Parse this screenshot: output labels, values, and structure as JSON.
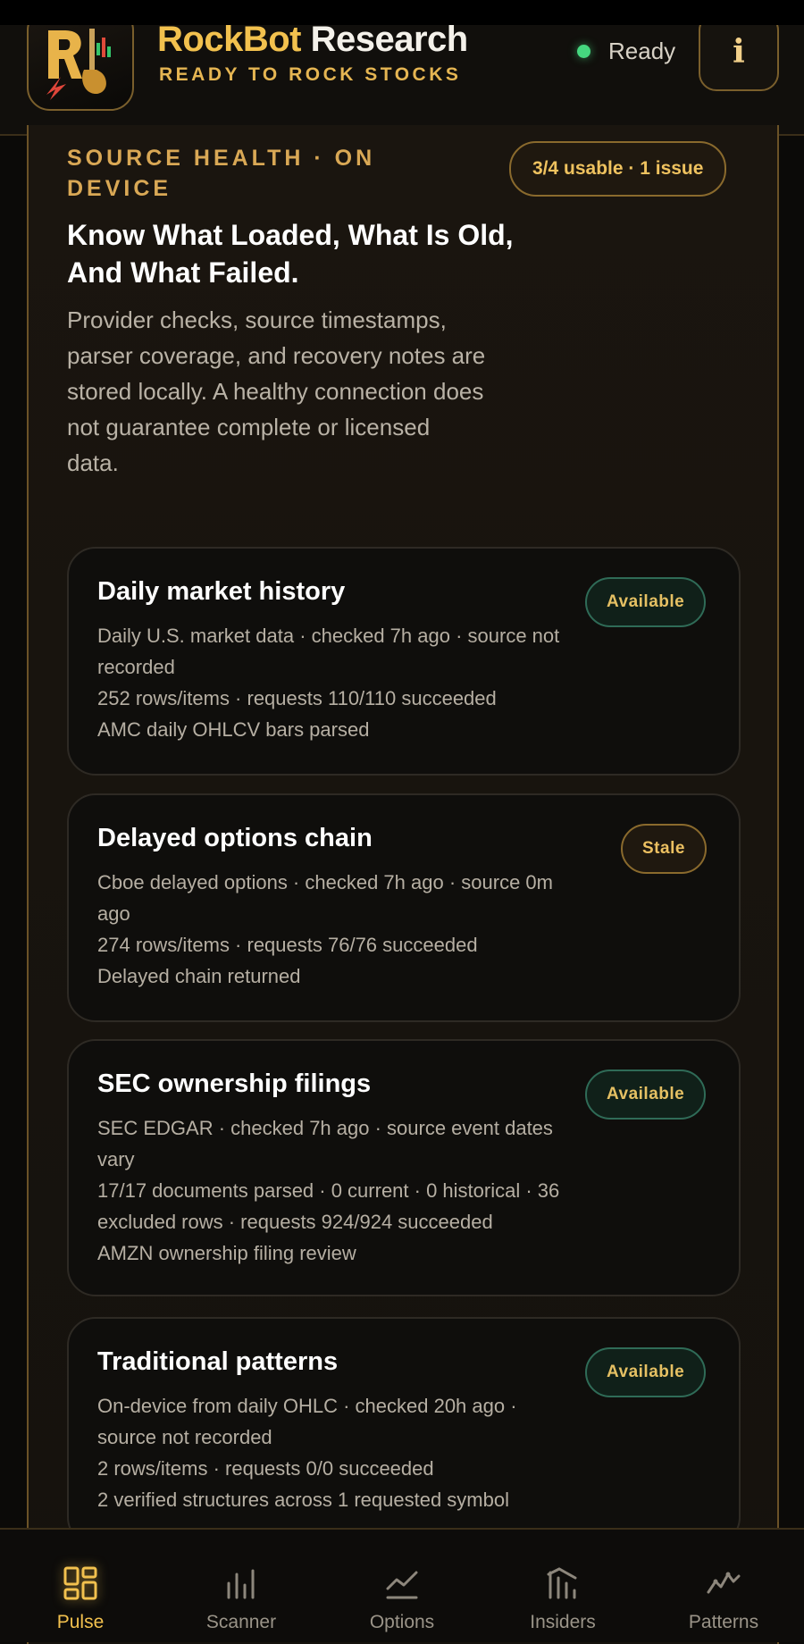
{
  "header": {
    "title_part1": "RockBot",
    "title_part2": " Research",
    "subtitle": "READY TO ROCK STOCKS",
    "status_label": "Ready",
    "info_label": "i",
    "logo_letter": "R",
    "logo_icon": "guitar-chart-logo"
  },
  "source_health": {
    "eyebrow": "SOURCE HEALTH · ON DEVICE",
    "summary_badge": "3/4 usable · 1 issue",
    "headline": "Know What Loaded, What Is Old, And What Failed.",
    "description": "Provider checks, source timestamps, parser coverage, and recovery notes are stored locally. A healthy connection does not guarantee complete or licensed data."
  },
  "sources": [
    {
      "title": "Daily market history",
      "status": "Available",
      "line1": "Daily U.S. market data · checked 7h ago · source not recorded",
      "line2": "252 rows/items · requests 110/110 succeeded",
      "line3": "AMC daily OHLCV bars parsed"
    },
    {
      "title": "Delayed options chain",
      "status": "Stale",
      "line1": "Cboe delayed options · checked 7h ago · source 0m ago",
      "line2": "274 rows/items · requests 76/76 succeeded",
      "line3": "Delayed chain returned"
    },
    {
      "title": "SEC ownership filings",
      "status": "Available",
      "line1": "SEC EDGAR · checked 7h ago · source event dates vary",
      "line2": "17/17 documents parsed · 0 current · 0 historical · 36 excluded rows · requests 924/924 succeeded",
      "line3": "AMZN ownership filing review"
    },
    {
      "title": "Traditional patterns",
      "status": "Available",
      "line1": "On-device from daily OHLC · checked 20h ago · source not recorded",
      "line2": "2 rows/items · requests 0/0 succeeded",
      "line3": "2 verified structures across 1 requested symbol"
    }
  ],
  "nav": [
    {
      "label": "Pulse",
      "icon": "dashboard-grid-icon",
      "active": true
    },
    {
      "label": "Scanner",
      "icon": "bar-chart-icon",
      "active": false
    },
    {
      "label": "Options",
      "icon": "line-chart-icon",
      "active": false
    },
    {
      "label": "Insiders",
      "icon": "columns-chart-icon",
      "active": false
    },
    {
      "label": "Patterns",
      "icon": "trend-pattern-icon",
      "active": false
    }
  ],
  "colors": {
    "accent_gold": "#f2c14e",
    "ready_green": "#45d77f",
    "available_border": "#2f6b57",
    "stale_border": "#8a6a2d",
    "background": "#0b0a08"
  }
}
